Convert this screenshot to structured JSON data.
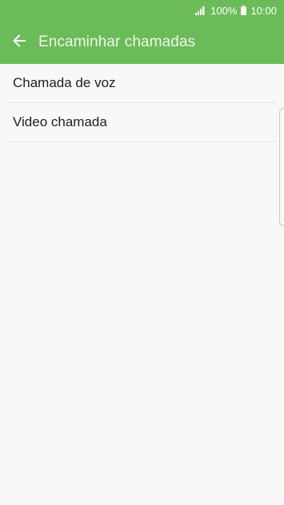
{
  "status_bar": {
    "battery_percent": "100%",
    "time": "10:00",
    "signal_icon": "signal-bars-icon",
    "battery_icon": "battery-icon"
  },
  "app_bar": {
    "back_icon": "arrow-back-icon",
    "title": "Encaminhar chamadas",
    "background_color": "#6bbb58"
  },
  "list": {
    "items": [
      {
        "label": "Chamada de voz"
      },
      {
        "label": "Video chamada"
      }
    ]
  }
}
